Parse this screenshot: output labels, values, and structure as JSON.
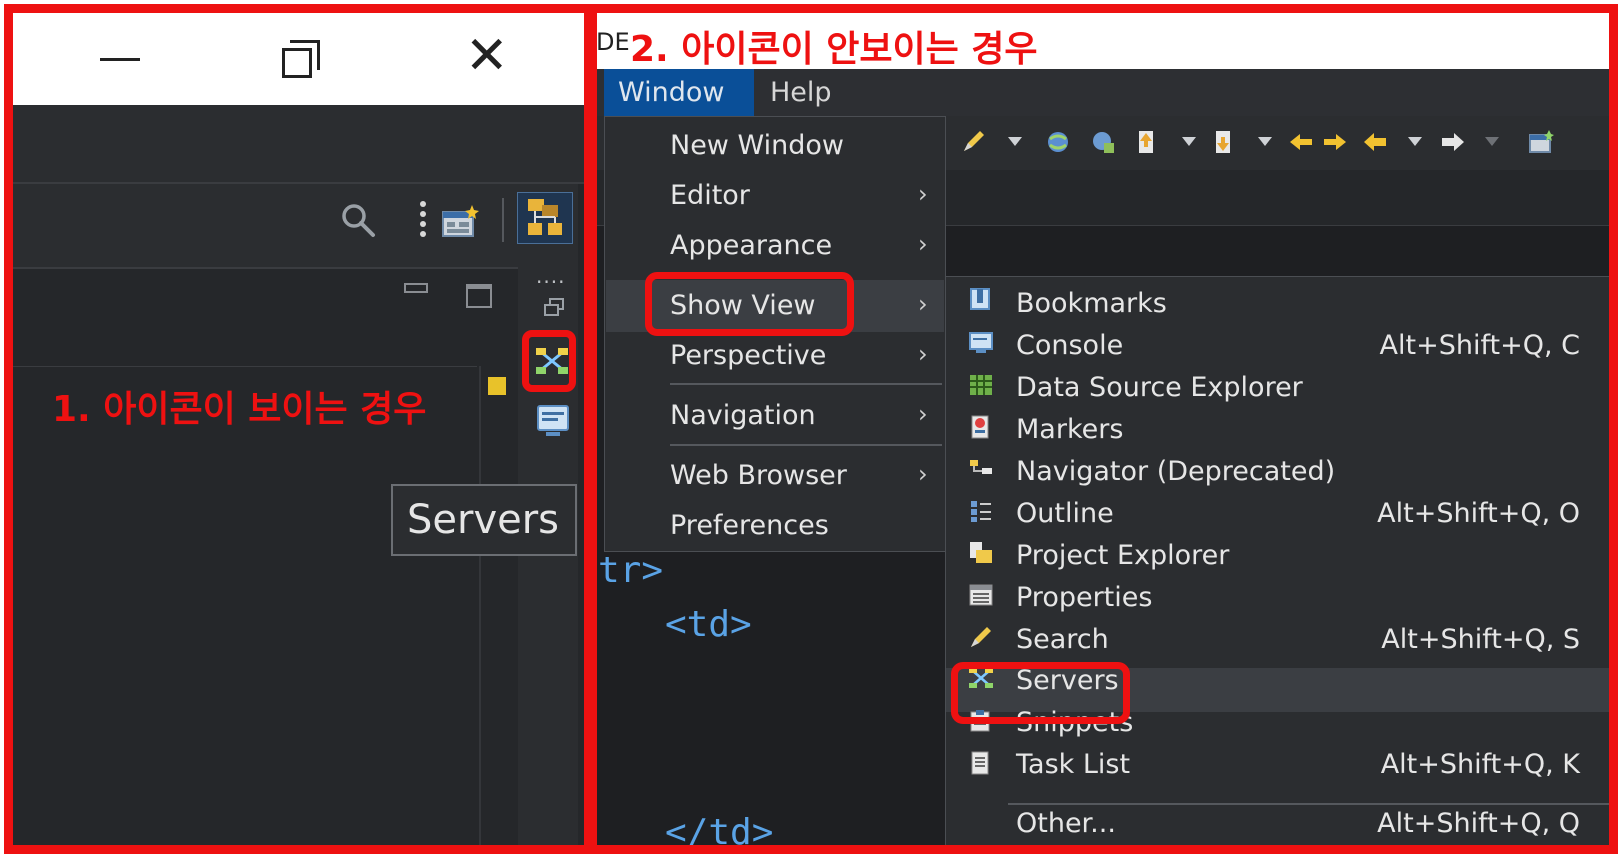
{
  "left_panel": {
    "caption": "1. 아이콘이 보이는 경우",
    "tooltip": "Servers",
    "window_controls": [
      "minimize-icon",
      "restore-icon",
      "close-icon"
    ],
    "toolbar_icons": [
      "search-icon",
      "view-menu-icon",
      "new-window-icon",
      "perspective-icon"
    ],
    "trim_icons": [
      "minimize-icon",
      "maximize-icon",
      "restore-icon",
      "servers-icon",
      "console-icon"
    ]
  },
  "right_panel": {
    "title_fragment": "DE",
    "caption": "2. 아이콘이 안보이는 경우",
    "menubar": {
      "window": "Window",
      "help": "Help"
    },
    "window_menu": {
      "items": [
        {
          "label": "New Window",
          "submenu": false
        },
        {
          "label": "Editor",
          "submenu": true
        },
        {
          "label": "Appearance",
          "submenu": true
        },
        {
          "label": "Show View",
          "submenu": true
        },
        {
          "label": "Perspective",
          "submenu": true
        },
        {
          "label": "Navigation",
          "submenu": true
        },
        {
          "label": "Web Browser",
          "submenu": true
        },
        {
          "label": "Preferences",
          "submenu": false
        }
      ],
      "submenu_arrow": "›"
    },
    "show_view_menu": {
      "items": [
        {
          "label": "Bookmarks",
          "shortcut": "",
          "icon": "bookmarks-icon"
        },
        {
          "label": "Console",
          "shortcut": "Alt+Shift+Q, C",
          "icon": "console-icon"
        },
        {
          "label": "Data Source Explorer",
          "shortcut": "",
          "icon": "data-source-icon"
        },
        {
          "label": "Markers",
          "shortcut": "",
          "icon": "markers-icon"
        },
        {
          "label": "Navigator (Deprecated)",
          "shortcut": "",
          "icon": "navigator-icon"
        },
        {
          "label": "Outline",
          "shortcut": "Alt+Shift+Q, O",
          "icon": "outline-icon"
        },
        {
          "label": "Project Explorer",
          "shortcut": "",
          "icon": "project-explorer-icon"
        },
        {
          "label": "Properties",
          "shortcut": "",
          "icon": "properties-icon"
        },
        {
          "label": "Search",
          "shortcut": "Alt+Shift+Q, S",
          "icon": "search-icon"
        },
        {
          "label": "Servers",
          "shortcut": "",
          "icon": "servers-icon"
        },
        {
          "label": "Snippets",
          "shortcut": "",
          "icon": "snippets-icon"
        },
        {
          "label": "Task List",
          "shortcut": "Alt+Shift+Q, K",
          "icon": "task-list-icon"
        },
        {
          "label": "Other...",
          "shortcut": "Alt+Shift+Q, Q",
          "icon": ""
        }
      ]
    },
    "code_lines": [
      "tr>",
      "<td>",
      "</td>"
    ]
  },
  "colors": {
    "highlight_red": "#ee1111",
    "menu_selected": "#0a4f98",
    "menu_bg": "#2b2d30",
    "editor_bg": "#1e1f22",
    "code_tag": "#5aa3e6"
  }
}
